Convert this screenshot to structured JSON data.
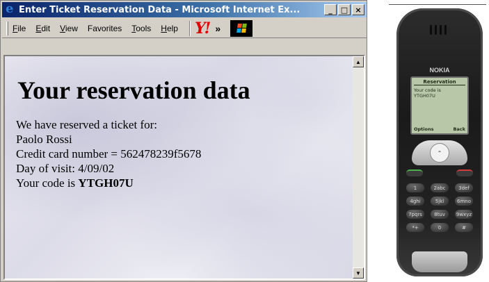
{
  "window": {
    "title": "Enter Ticket Reservation Data - Microsoft Internet Ex...",
    "buttons": {
      "minimize": "_",
      "maximize": "□",
      "close": "×"
    }
  },
  "menu": {
    "items": [
      {
        "first": "F",
        "rest": "ile"
      },
      {
        "first": "E",
        "rest": "dit"
      },
      {
        "first": "V",
        "rest": "iew"
      },
      {
        "first": "F",
        "pre": "",
        "rest": "avorites",
        "display": "Favorites"
      },
      {
        "first": "T",
        "rest": "ools"
      },
      {
        "first": "H",
        "rest": "elp"
      }
    ],
    "yahoo_icon": "Y!",
    "more_label": "»"
  },
  "page": {
    "heading": "Your reservation data",
    "lines": [
      "We have reserved a ticket for:",
      "Paolo Rossi",
      "Credit card number = 562478239f5678",
      "Day of visit: 4/09/02"
    ],
    "code_prefix": "Your code is ",
    "code": "YTGH07U"
  },
  "scrollbar": {
    "up": "▲",
    "down": "▼"
  },
  "phone": {
    "brand": "NOKIA",
    "screen_title": "Reservation",
    "screen_lines": [
      "Your code is",
      "YTGH07U"
    ],
    "softkey_left": "Options",
    "softkey_right": "Back",
    "keys": [
      "1",
      "2abc",
      "3def",
      "4ghi",
      "5jkl",
      "6mno",
      "7pqrs",
      "8tuv",
      "9wxyz",
      "*+",
      "0",
      "#"
    ]
  },
  "colors": {
    "titlebar_start": "#0a246a",
    "titlebar_end": "#a6caf0",
    "window_chrome": "#d4d0c8",
    "yahoo_red": "#e00000",
    "phone_screen": "#b8c7a8"
  }
}
